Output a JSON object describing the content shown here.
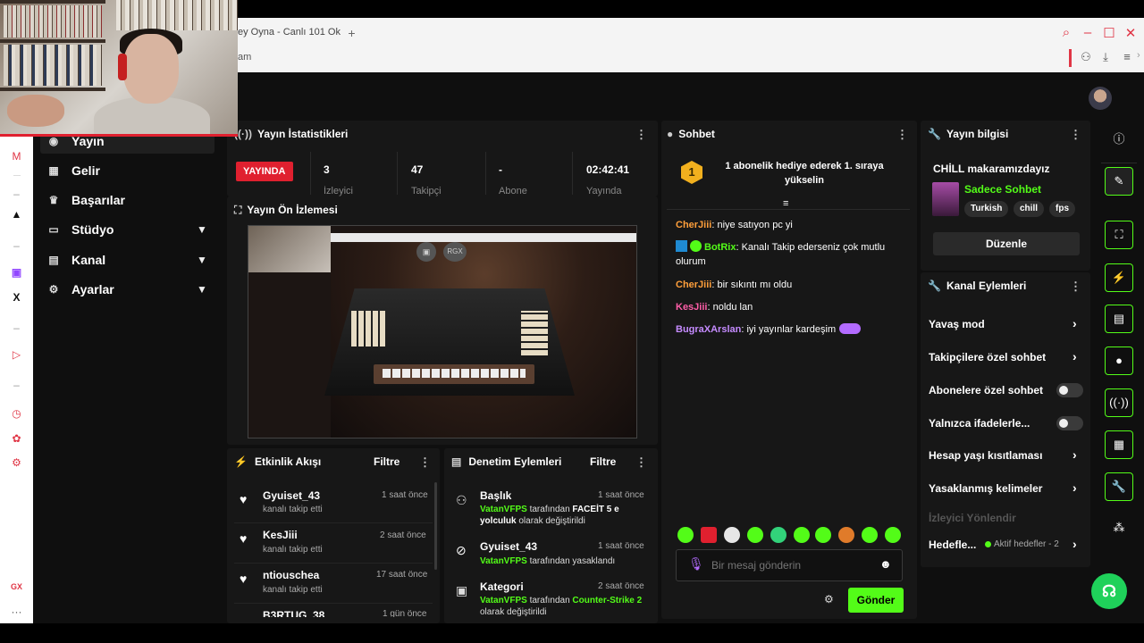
{
  "browser": {
    "tab_title": "ey Oyna - Canlı 101 Ok",
    "url_fragment": "am"
  },
  "sidebar": {
    "items": [
      {
        "label": "Yayın"
      },
      {
        "label": "Gelir"
      },
      {
        "label": "Başarılar"
      },
      {
        "label": "Stüdyo"
      },
      {
        "label": "Kanal"
      },
      {
        "label": "Ayarlar"
      }
    ]
  },
  "stats_panel": {
    "title": "Yayın İstatistikleri",
    "live_label": "YAYINDA",
    "viewers_value": "3",
    "viewers_label": "İzleyici",
    "followers_value": "47",
    "followers_label": "Takipçi",
    "subs_value": "-",
    "subs_label": "Abone",
    "uptime_value": "02:42:41",
    "uptime_label": "Yayında"
  },
  "preview_panel": {
    "title": "Yayın Ön İzlemesi",
    "badge": "RGX"
  },
  "activity_panel": {
    "title": "Etkinlik Akışı",
    "filter_label": "Filtre",
    "items": [
      {
        "name": "Gyuiset_43",
        "action": "kanalı takip etti",
        "time": "1 saat önce"
      },
      {
        "name": "KesJiii",
        "action": "kanalı takip etti",
        "time": "2 saat önce"
      },
      {
        "name": "ntiouschea",
        "action": "kanalı takip etti",
        "time": "17 saat önce"
      },
      {
        "name": "B3RTUG_38",
        "action": "",
        "time": "1 gün önce"
      }
    ]
  },
  "moderation_panel": {
    "title": "Denetim Eylemleri",
    "filter_label": "Filtre",
    "items": [
      {
        "title": "Başlık",
        "time": "1 saat önce",
        "actor": "VatanVFPS",
        "text1": " tarafından ",
        "highlight": "FACEİT 5 e yolculuk",
        "text2": " olarak değiştirildi"
      },
      {
        "title": "Gyuiset_43",
        "time": "1 saat önce",
        "actor": "VatanVFPS",
        "text1": " tarafından yasaklandı",
        "highlight": "",
        "text2": ""
      },
      {
        "title": "Kategori",
        "time": "2 saat önce",
        "actor": "VatanVFPS",
        "text1": " tarafından ",
        "highlight": "Counter-Strike 2",
        "text2": " olarak değiştirildi"
      }
    ]
  },
  "chat_panel": {
    "title": "Sohbet",
    "gift_rank": "1",
    "gift_text": "1 abonelik hediye ederek 1. sıraya yükselin",
    "messages": [
      {
        "user": "CherJiii",
        "color": "#ff9f3b",
        "text": ": niye satıyon pc yi"
      },
      {
        "user": "BotRix",
        "color": "#53fc18",
        "text": ": Kanalı Takip ederseniz çok mutlu olurum"
      },
      {
        "user": "CherJiii",
        "color": "#ff9f3b",
        "text": ": bir sıkıntı mı oldu"
      },
      {
        "user": "KesJiii",
        "color": "#ff5ea8",
        "text": ": noldu lan"
      },
      {
        "user": "BugraXArslan",
        "color": "#c58bff",
        "text": ": iyi yayınlar kardeşim"
      }
    ],
    "input_placeholder": "Bir mesaj gönderin",
    "send_label": "Gönder"
  },
  "stream_info_panel": {
    "title": "Yayın bilgisi",
    "stream_title": "CHİLL makaramızdayız",
    "category": "Sadece Sohbet",
    "tags": [
      "Turkish",
      "chill",
      "fps"
    ],
    "edit_label": "Düzenle"
  },
  "channel_actions_panel": {
    "title": "Kanal Eylemleri",
    "rows": [
      {
        "label": "Yavaş mod"
      },
      {
        "label": "Takipçilere özel sohbet"
      },
      {
        "label": "Abonelere özel sohbet"
      },
      {
        "label": "Yalnızca ifadelerle..."
      },
      {
        "label": "Hesap yaşı kısıtlaması"
      },
      {
        "label": "Yasaklanmış kelimeler"
      }
    ],
    "redirect_label": "İzleyici Yönlendir",
    "goals_label": "Hedefle...",
    "goals_status": "Aktif hedefler - 2"
  },
  "colors": {
    "accent": "#53fc18",
    "live": "#e0202f",
    "panel": "#171717",
    "background": "#0f0f0f"
  }
}
